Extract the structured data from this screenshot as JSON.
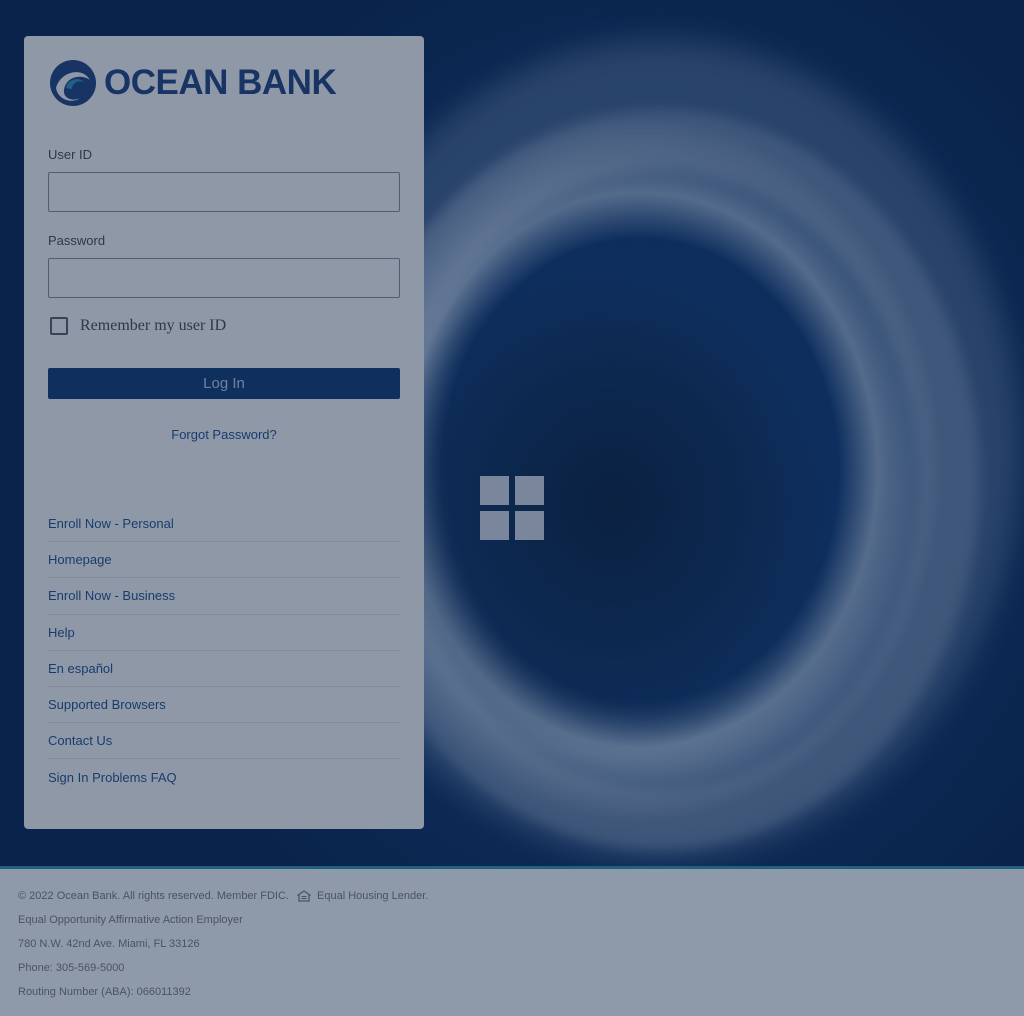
{
  "brand": {
    "name": "OCEAN BANK",
    "logo_icon": "ocean-bank-wave-logo",
    "primary_color": "#12396f"
  },
  "login_form": {
    "user_id_label": "User ID",
    "user_id_value": "",
    "password_label": "Password",
    "password_value": "",
    "remember_label": "Remember my user ID",
    "remember_checked": false,
    "login_button": "Log In",
    "forgot_password": "Forgot Password?"
  },
  "links": [
    "Enroll Now - Personal",
    "Homepage",
    "Enroll Now - Business",
    "Help",
    "En español",
    "Supported Browsers",
    "Contact Us",
    "Sign In Problems FAQ"
  ],
  "loader": {
    "icon": "loading-grid-icon"
  },
  "footer": {
    "copyright": "© 2022 Ocean Bank. All rights reserved. Member FDIC.",
    "housing_icon": "equal-housing-icon",
    "housing": "Equal Housing Lender.",
    "eoe": "Equal Opportunity Affirmative Action Employer",
    "address": "780 N.W. 42nd Ave. Miami, FL 33126",
    "phone": "Phone: 305-569-5000",
    "routing": "Routing Number (ABA): 066011392"
  }
}
